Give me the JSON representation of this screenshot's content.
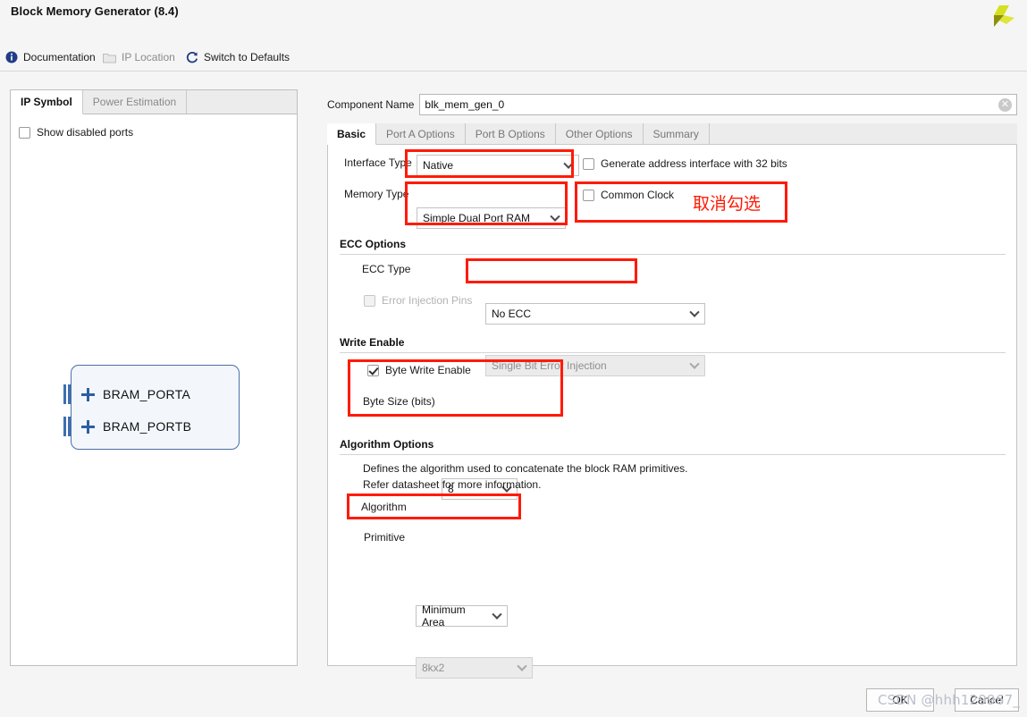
{
  "window": {
    "title": "Block Memory Generator (8.4)",
    "logo_icon": "xilinx-logo-icon"
  },
  "toolbar": {
    "documentation": "Documentation",
    "documentation_icon": "info-icon",
    "ip_location": "IP Location",
    "ip_location_icon": "folder-icon",
    "switch_to_defaults": "Switch to Defaults",
    "switch_to_defaults_icon": "refresh-icon"
  },
  "left_panel": {
    "tabs": [
      {
        "label": "IP Symbol",
        "active": true
      },
      {
        "label": "Power Estimation",
        "active": false
      }
    ],
    "show_disabled_ports": {
      "label": "Show disabled ports",
      "checked": false
    },
    "symbol": {
      "ports": [
        {
          "name": "BRAM_PORTA",
          "expand_icon": "plus-icon",
          "bus_icon": "bus-bars-icon"
        },
        {
          "name": "BRAM_PORTB",
          "expand_icon": "plus-icon",
          "bus_icon": "bus-bars-icon"
        }
      ]
    }
  },
  "main": {
    "component_name_label": "Component Name",
    "component_name_value": "blk_mem_gen_0",
    "component_name_clear_icon": "clear-circle-icon",
    "tabs": [
      {
        "label": "Basic",
        "active": true
      },
      {
        "label": "Port A Options",
        "active": false
      },
      {
        "label": "Port B Options",
        "active": false
      },
      {
        "label": "Other Options",
        "active": false
      },
      {
        "label": "Summary",
        "active": false
      }
    ],
    "interface_type": {
      "label": "Interface Type",
      "value": "Native",
      "chevron_icon": "chevron-down-icon"
    },
    "generate_address": {
      "label": "Generate address interface with 32 bits",
      "checked": false
    },
    "memory_type": {
      "label": "Memory Type",
      "value": "Simple Dual Port RAM",
      "chevron_icon": "chevron-down-icon"
    },
    "common_clock": {
      "label": "Common Clock",
      "checked": false
    },
    "ecc_options": {
      "section_title": "ECC Options",
      "ecc_type": {
        "label": "ECC Type",
        "value": "No ECC",
        "chevron_icon": "chevron-down-icon"
      },
      "error_injection_pins": {
        "label": "Error Injection Pins",
        "checked": false,
        "disabled": true,
        "value": "Single Bit Error Injection",
        "chevron_icon": "chevron-down-icon"
      }
    },
    "write_enable": {
      "section_title": "Write Enable",
      "byte_write_enable": {
        "label": "Byte Write Enable",
        "checked": true
      },
      "byte_size": {
        "label": "Byte Size (bits)",
        "value": "8",
        "chevron_icon": "chevron-down-icon"
      }
    },
    "algorithm_options": {
      "section_title": "Algorithm Options",
      "help_line_1": "Defines the algorithm used to concatenate the block RAM primitives.",
      "help_line_2": "Refer datasheet for more information.",
      "algorithm": {
        "label": "Algorithm",
        "value": "Minimum Area",
        "chevron_icon": "chevron-down-icon"
      },
      "primitive": {
        "label": "Primitive",
        "value": "8kx2",
        "disabled": true,
        "chevron_icon": "chevron-down-icon"
      }
    }
  },
  "footer": {
    "ok_label": "OK",
    "cancel_label": "Cancel",
    "watermark": "CSDN @hhh129967_"
  },
  "annotations": {
    "uncheck_note": "取消勾选",
    "highlight_color": "#ff1a05"
  }
}
